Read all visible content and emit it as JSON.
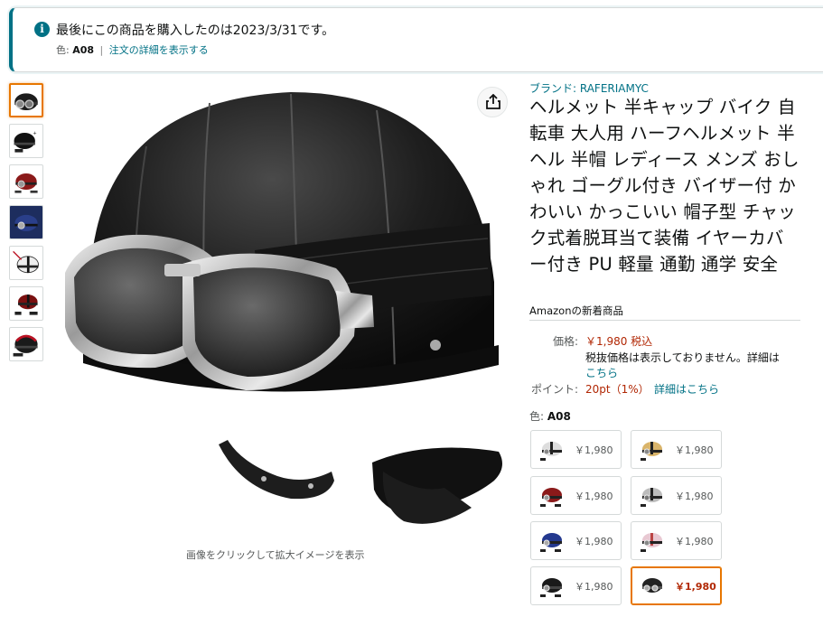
{
  "notice": {
    "message": "最後にこの商品を購入したのは2023/3/31です。",
    "color_label": "色:",
    "color_value": "A08",
    "separator": "|",
    "order_link": "注文の詳細を表示する"
  },
  "gallery": {
    "zoom_hint": "画像をクリックして拡大イメージを表示",
    "thumbnail_variants": [
      "black-goggles",
      "black-set",
      "red",
      "blue",
      "white-stripe",
      "red-black",
      "black-red"
    ]
  },
  "product": {
    "brand": "ブランド: RAFERIAMYC",
    "title": "ヘルメット 半キャップ バイク 自転車 大人用 ハーフヘルメット 半ヘル 半帽 レディース メンズ おしゃれ ゴーグル付き バイザー付 かわいい かっこいい 帽子型 チャック式着脱耳当て装備 イヤーカバー付き PU 軽量 通勤 通学 安全",
    "new_items": "Amazonの新着商品"
  },
  "pricing": {
    "price_label": "価格:",
    "price_value": "￥1,980 税込",
    "tax_note": "税抜価格は表示しておりません。詳細は",
    "tax_link": "こちら",
    "points_label": "ポイント:",
    "points_value": "20pt（1%）",
    "points_link": "詳細はこちら"
  },
  "variants": {
    "label": "色:",
    "selected": "A08",
    "options": [
      {
        "price": "￥1,980",
        "color": "#7a6a3a"
      },
      {
        "price": "￥1,980",
        "color": "#c9a24a"
      },
      {
        "price": "￥1,980",
        "color": "#8b1a1a"
      },
      {
        "price": "￥1,980",
        "color": "#9a9a9a"
      },
      {
        "price": "￥1,980",
        "color": "#1e2f7a"
      },
      {
        "price": "￥1,980",
        "color": "#c79aa6"
      },
      {
        "price": "￥1,980",
        "color": "#222222"
      },
      {
        "price": "￥1,980",
        "color": "#333333"
      }
    ]
  },
  "colors": {
    "accent_teal": "#007185",
    "price_red": "#b12704",
    "selected_orange": "#e77600"
  }
}
